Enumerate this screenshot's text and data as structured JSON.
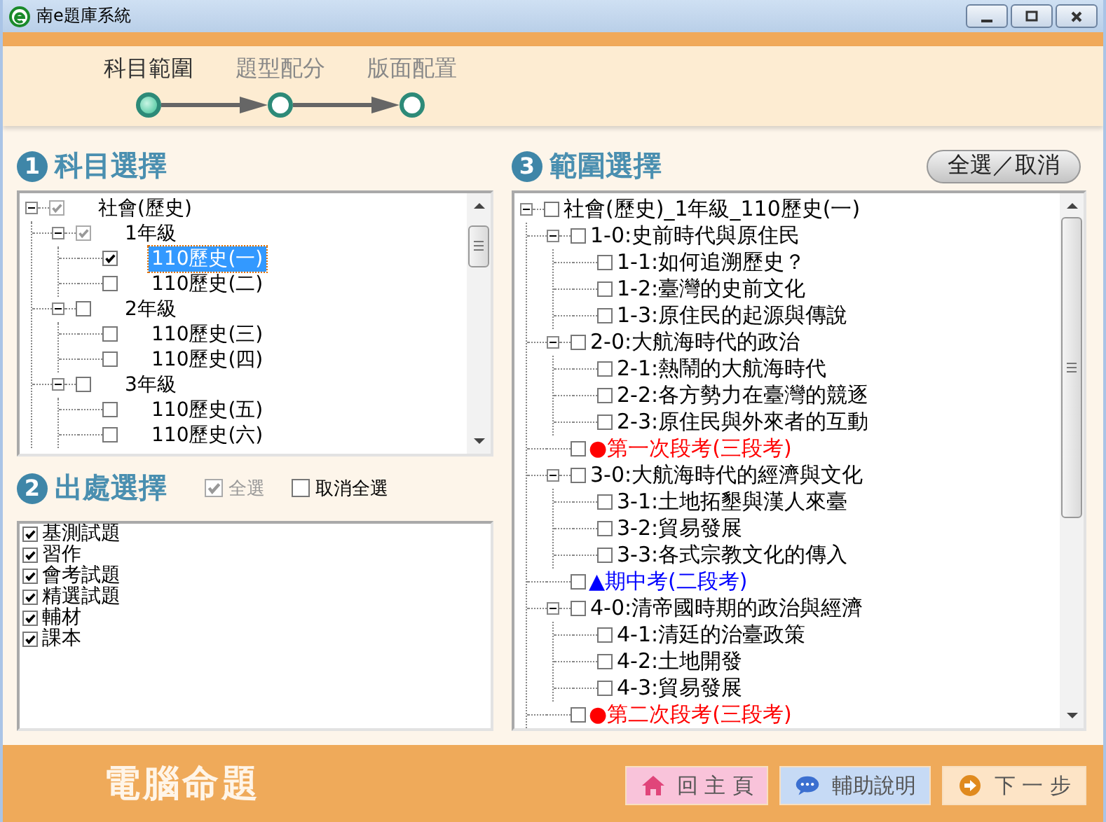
{
  "window": {
    "title": "南e題庫系統"
  },
  "steps": [
    {
      "label": "科目範圍",
      "selected": true
    },
    {
      "label": "題型配分",
      "selected": false
    },
    {
      "label": "版面配置",
      "selected": false
    }
  ],
  "subject_section": {
    "number": "1",
    "title": "科目選擇",
    "tree": [
      {
        "label": "社會(歷史)",
        "checked": true,
        "partial": true,
        "selected": false,
        "expanded": true,
        "children": [
          {
            "label": "1年級",
            "checked": true,
            "partial": true,
            "selected": false,
            "expanded": true,
            "children": [
              {
                "label": "110歷史(一)",
                "checked": true,
                "partial": false,
                "selected": true
              },
              {
                "label": "110歷史(二)",
                "checked": false,
                "partial": false,
                "selected": false
              }
            ]
          },
          {
            "label": "2年級",
            "checked": false,
            "partial": false,
            "selected": false,
            "expanded": true,
            "children": [
              {
                "label": "110歷史(三)",
                "checked": false,
                "partial": false,
                "selected": false
              },
              {
                "label": "110歷史(四)",
                "checked": false,
                "partial": false,
                "selected": false
              }
            ]
          },
          {
            "label": "3年級",
            "checked": false,
            "partial": false,
            "selected": false,
            "expanded": true,
            "children": [
              {
                "label": "110歷史(五)",
                "checked": false,
                "partial": false,
                "selected": false
              },
              {
                "label": "110歷史(六)",
                "checked": false,
                "partial": false,
                "selected": false
              }
            ]
          }
        ]
      }
    ]
  },
  "source_section": {
    "number": "2",
    "title": "出處選擇",
    "select_all": {
      "label": "全選",
      "checked": true,
      "disabled": true
    },
    "clear_all": {
      "label": "取消全選",
      "checked": false,
      "disabled": false
    },
    "items": [
      {
        "label": "基測試題",
        "checked": true
      },
      {
        "label": "習作",
        "checked": true
      },
      {
        "label": "會考試題",
        "checked": true
      },
      {
        "label": "精選試題",
        "checked": true
      },
      {
        "label": "輔材",
        "checked": true
      },
      {
        "label": "課本",
        "checked": true
      }
    ]
  },
  "range_section": {
    "number": "3",
    "title": "範圍選擇",
    "toggle_button": "全選／取消",
    "tree": [
      {
        "kind": "unit",
        "label": "社會(歷史)_1年級_110歷史(一)",
        "checked": false,
        "expanded": true,
        "children": [
          {
            "kind": "unit",
            "label": "1-0:史前時代與原住民",
            "checked": false,
            "expanded": true,
            "children": [
              {
                "kind": "unit",
                "label": "1-1:如何追溯歷史？",
                "checked": false
              },
              {
                "kind": "unit",
                "label": "1-2:臺灣的史前文化",
                "checked": false
              },
              {
                "kind": "unit",
                "label": "1-3:原住民的起源與傳說",
                "checked": false
              }
            ]
          },
          {
            "kind": "unit",
            "label": "2-0:大航海時代的政治",
            "checked": false,
            "expanded": true,
            "children": [
              {
                "kind": "unit",
                "label": "2-1:熱鬧的大航海時代",
                "checked": false
              },
              {
                "kind": "unit",
                "label": "2-2:各方勢力在臺灣的競逐",
                "checked": false
              },
              {
                "kind": "unit",
                "label": "2-3:原住民與外來者的互動",
                "checked": false
              }
            ]
          },
          {
            "kind": "exam",
            "symbol": "●",
            "color": "#ff0000",
            "label": "第一次段考(三段考)",
            "checked": false
          },
          {
            "kind": "unit",
            "label": "3-0:大航海時代的經濟與文化",
            "checked": false,
            "expanded": true,
            "children": [
              {
                "kind": "unit",
                "label": "3-1:土地拓墾與漢人來臺",
                "checked": false
              },
              {
                "kind": "unit",
                "label": "3-2:貿易發展",
                "checked": false
              },
              {
                "kind": "unit",
                "label": "3-3:各式宗教文化的傳入",
                "checked": false
              }
            ]
          },
          {
            "kind": "exam",
            "symbol": "▲",
            "color": "#0000ff",
            "label": "期中考(二段考)",
            "checked": false
          },
          {
            "kind": "unit",
            "label": "4-0:清帝國時期的政治與經濟",
            "checked": false,
            "expanded": true,
            "children": [
              {
                "kind": "unit",
                "label": "4-1:清廷的治臺政策",
                "checked": false
              },
              {
                "kind": "unit",
                "label": "4-2:土地開發",
                "checked": false
              },
              {
                "kind": "unit",
                "label": "4-3:貿易發展",
                "checked": false
              }
            ]
          },
          {
            "kind": "exam",
            "symbol": "●",
            "color": "#ff0000",
            "label": "第二次段考(三段考)",
            "checked": false
          }
        ]
      }
    ]
  },
  "footer": {
    "title": "電腦命題",
    "buttons": [
      {
        "kind": "home",
        "label": "回 主 頁"
      },
      {
        "kind": "help",
        "label": "輔助說明"
      },
      {
        "kind": "next",
        "label": "下 一 步"
      }
    ]
  }
}
